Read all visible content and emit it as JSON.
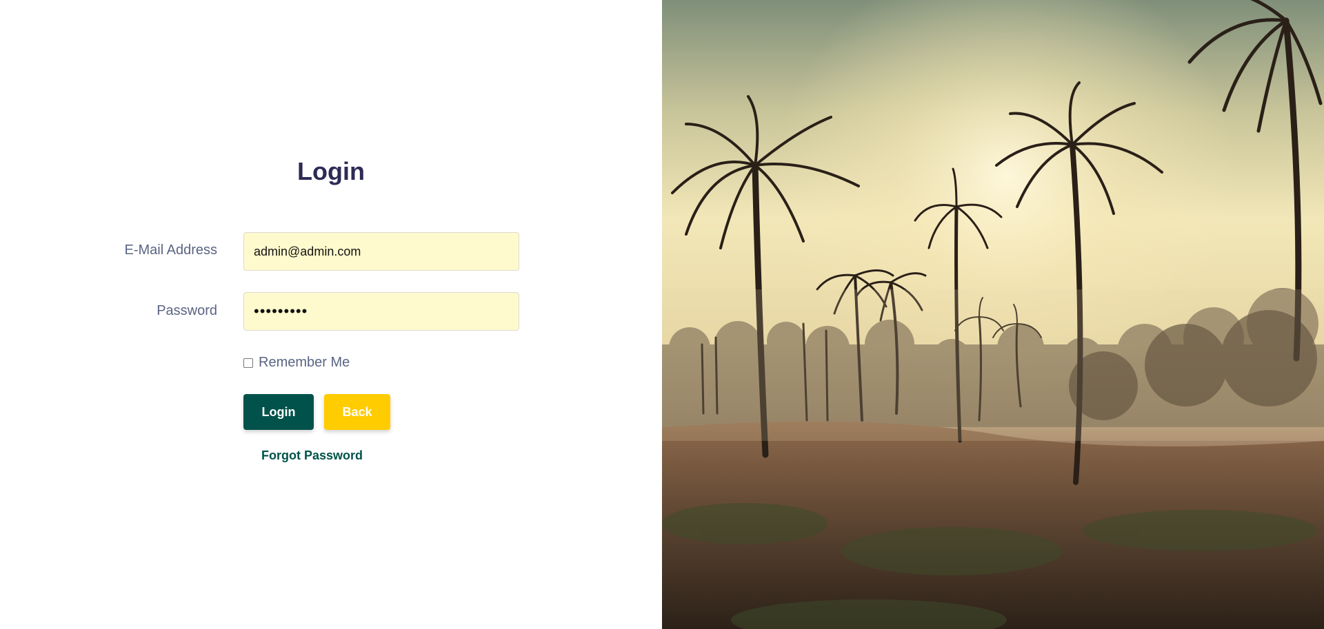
{
  "login": {
    "title": "Login",
    "email_label": "E-Mail Address",
    "email_value": "admin@admin.com",
    "password_label": "Password",
    "password_value": "•••••••••",
    "remember_label": "Remember Me",
    "remember_checked": false,
    "login_button": "Login",
    "back_button": "Back",
    "forgot_link": "Forgot Password"
  },
  "colors": {
    "primary": "#00524a",
    "secondary": "#ffcc00",
    "title": "#2d2b55",
    "label": "#5a6483",
    "input_bg": "#fffacd"
  },
  "hero": {
    "image_subject": "palm-trees-sunset-image"
  }
}
